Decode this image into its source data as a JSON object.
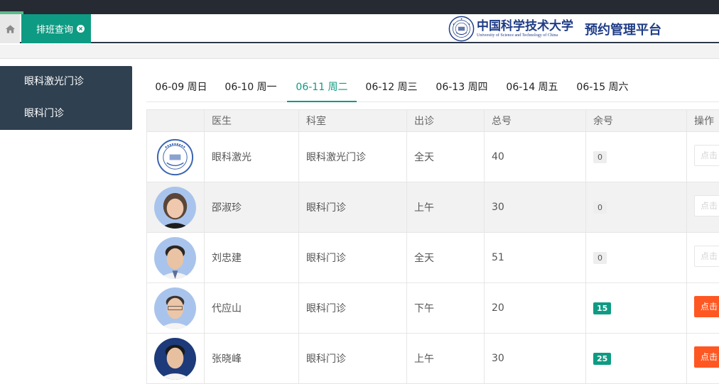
{
  "header": {
    "tab_label": "排班查询",
    "brand_cn": "中国科学技术大学",
    "brand_en": "University of Science and Technology of China",
    "platform": "预约管理平台"
  },
  "sidebar": {
    "items": [
      {
        "label": "眼科激光门诊"
      },
      {
        "label": "眼科门诊"
      }
    ]
  },
  "days": [
    {
      "label": "06-09 周日"
    },
    {
      "label": "06-10 周一"
    },
    {
      "label": "06-11 周二"
    },
    {
      "label": "06-12 周三"
    },
    {
      "label": "06-13 周四"
    },
    {
      "label": "06-14 周五"
    },
    {
      "label": "06-15 周六"
    }
  ],
  "active_day": 2,
  "table": {
    "columns": {
      "doctor": "医生",
      "dept": "科室",
      "session": "出诊",
      "total": "总号",
      "remaining": "余号",
      "action": "操作"
    },
    "rows": [
      {
        "doctor": "眼科激光",
        "dept": "眼科激光门诊",
        "session": "全天",
        "total": "40",
        "remaining": "0",
        "action": "点击"
      },
      {
        "doctor": "邵淑珍",
        "dept": "眼科门诊",
        "session": "上午",
        "total": "30",
        "remaining": "0",
        "action": "点击"
      },
      {
        "doctor": "刘忠建",
        "dept": "眼科门诊",
        "session": "全天",
        "total": "51",
        "remaining": "0",
        "action": "点击"
      },
      {
        "doctor": "代应山",
        "dept": "眼科门诊",
        "session": "下午",
        "total": "20",
        "remaining": "15",
        "action": "点击"
      },
      {
        "doctor": "张晓峰",
        "dept": "眼科门诊",
        "session": "上午",
        "total": "30",
        "remaining": "25",
        "action": "点击"
      }
    ]
  },
  "colors": {
    "accent": "#0e9b83",
    "sidebar": "#2f4050",
    "action": "#ff5722",
    "brand": "#1f3c86"
  }
}
